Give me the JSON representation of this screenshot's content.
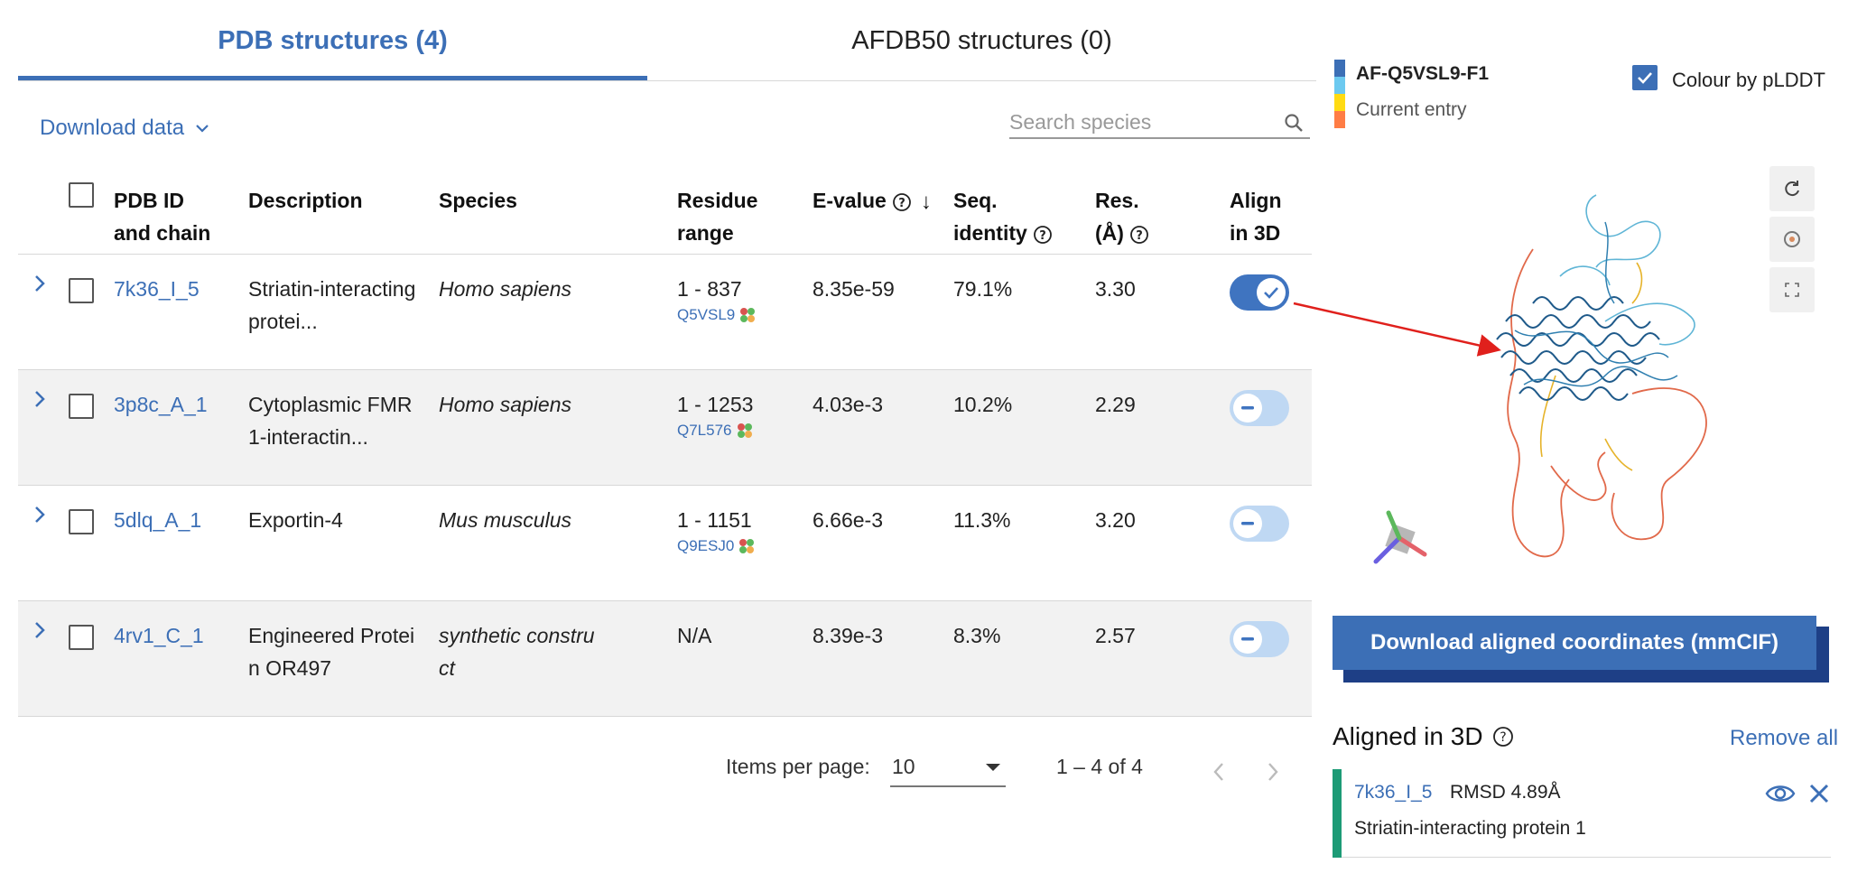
{
  "tabs": [
    {
      "label": "PDB structures (4)"
    },
    {
      "label": "AFDB50 structures (0)"
    }
  ],
  "toolbar": {
    "download_label": "Download data",
    "search_placeholder": "Search species"
  },
  "table": {
    "headers": {
      "pdb_id_line1": "PDB ID",
      "pdb_id_line2": "and chain",
      "description": "Description",
      "species": "Species",
      "residue_line1": "Residue",
      "residue_line2": "range",
      "evalue": "E-value",
      "seq_line1": "Seq.",
      "seq_line2": "identity",
      "res_line1": "Res.",
      "res_line2": "(Å)",
      "align_line1": "Align",
      "align_line2": "in 3D"
    },
    "rows": [
      {
        "pdb_id": "7k36_I_5",
        "desc1": "Striatin-interacting",
        "desc2": "protei...",
        "species1": "Homo sapiens",
        "species2": "",
        "range": "1 - 837",
        "uniprot": "Q5VSL9",
        "evalue": "8.35e-59",
        "identity": "79.1%",
        "resolution": "3.30",
        "aligned": true
      },
      {
        "pdb_id": "3p8c_A_1",
        "desc1": "Cytoplasmic FMR",
        "desc2": "1-interactin...",
        "species1": "Homo sapiens",
        "species2": "",
        "range": "1 - 1253",
        "uniprot": "Q7L576",
        "evalue": "4.03e-3",
        "identity": "10.2%",
        "resolution": "2.29",
        "aligned": false
      },
      {
        "pdb_id": "5dlq_A_1",
        "desc1": "Exportin-4",
        "desc2": "",
        "species1": "Mus musculus",
        "species2": "",
        "range": "1 - 1151",
        "uniprot": "Q9ESJ0",
        "evalue": "6.66e-3",
        "identity": "11.3%",
        "resolution": "3.20",
        "aligned": false
      },
      {
        "pdb_id": "4rv1_C_1",
        "desc1": "Engineered Protei",
        "desc2": "n OR497",
        "species1": "synthetic constru",
        "species2": "ct",
        "range": "N/A",
        "uniprot": "",
        "evalue": "8.39e-3",
        "identity": "8.3%",
        "resolution": "2.57",
        "aligned": false
      }
    ]
  },
  "paginator": {
    "items_per_page_label": "Items per page:",
    "items_per_page_value": "10",
    "range_label": "1 – 4 of 4"
  },
  "legend": {
    "entry_id": "AF-Q5VSL9-F1",
    "entry_sub": "Current entry",
    "colors": [
      "#3c6fb6",
      "#6cc9f0",
      "#ffdb13",
      "#ff7d45"
    ]
  },
  "colour_by_plddt": {
    "label": "Colour by pLDDT",
    "checked": true
  },
  "download_aligned_label": "Download aligned coordinates (mmCIF)",
  "aligned_panel": {
    "title": "Aligned in 3D",
    "remove_all": "Remove all",
    "item": {
      "id": "7k36_I_5",
      "rmsd": "RMSD 4.89Å",
      "description": "Striatin-interacting protein 1"
    }
  },
  "colors": {
    "accent": "#3c6fb6",
    "accent_dark": "#1e3f86",
    "aligned_stripe": "#1d9b76",
    "arrow": "#e0201c"
  }
}
